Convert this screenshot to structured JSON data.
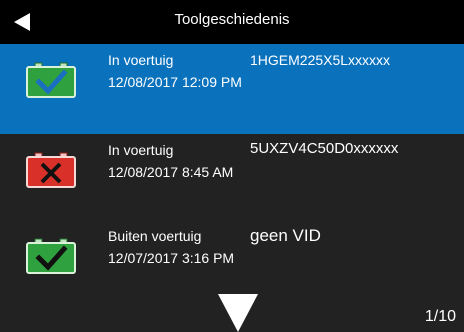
{
  "header": {
    "title": "Toolgeschiedenis"
  },
  "icons": {
    "back": "triangle-left-icon",
    "battery_ok": "battery-check-icon",
    "battery_fail": "battery-x-icon",
    "scroll_down": "triangle-down-icon"
  },
  "colors": {
    "header_bg": "#000000",
    "list_bg": "#222222",
    "selected_bg": "#0a72bd",
    "battery_ok": "#2a9a3a",
    "battery_fail": "#d9302a",
    "check_mark": "#1a6fc0"
  },
  "items": [
    {
      "location": "In voertuig",
      "vid": "1HGEM225X5Lxxxxxx",
      "datetime": "12/08/2017 12:09 PM",
      "status": "ok",
      "selected": true
    },
    {
      "location": "In voertuig",
      "vid": "5UXZV4C50D0xxxxxx",
      "datetime": "12/08/2017  8:45 AM",
      "status": "fail",
      "selected": false
    },
    {
      "location": "Buiten voertuig",
      "vid": "geen VID",
      "datetime": "12/07/2017  3:16 PM",
      "status": "ok",
      "selected": false
    }
  ],
  "pagination": {
    "indicator": "1/10"
  }
}
